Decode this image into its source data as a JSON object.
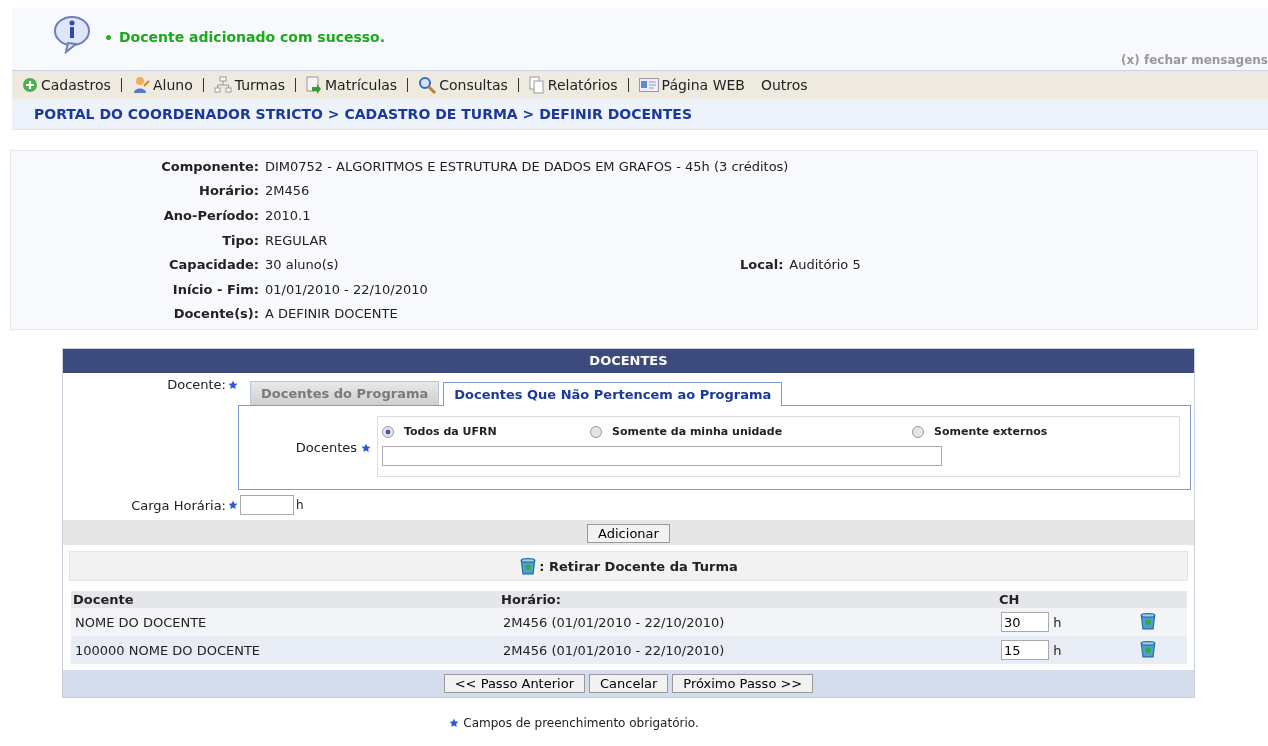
{
  "message": {
    "text": "Docente adicionado com sucesso.",
    "close": "(x) fechar mensagens"
  },
  "menu": [
    {
      "label": "Cadastros",
      "kind": "plus"
    },
    {
      "label": "Aluno",
      "kind": "person"
    },
    {
      "label": "Turmas",
      "kind": "tree"
    },
    {
      "label": "Matrículas",
      "kind": "document"
    },
    {
      "label": "Consultas",
      "kind": "search"
    },
    {
      "label": "Relatórios",
      "kind": "pages"
    },
    {
      "label": "Página WEB",
      "kind": "card"
    },
    {
      "label": "Outros",
      "kind": "plain"
    }
  ],
  "breadcrumb": "PORTAL DO COORDENADOR STRICTO > CADASTRO DE TURMA > DEFINIR DOCENTES",
  "details": [
    {
      "label": "Componente:",
      "value": "DIM0752 - ALGORITMOS E ESTRUTURA DE DADOS EM GRAFOS - 45h (3 créditos)"
    },
    {
      "label": "Horário:",
      "value": "2M456"
    },
    {
      "label": "Ano-Período:",
      "value": "2010.1"
    },
    {
      "label": "Tipo:",
      "value": "REGULAR"
    },
    {
      "label": "Capacidade:",
      "value": "30 aluno(s)",
      "extra_label": "Local:",
      "extra_value": "Auditório 5"
    },
    {
      "label": "Início - Fim:",
      "value": "01/01/2010 - 22/10/2010"
    },
    {
      "label": "Docente(s):",
      "value": "A DEFINIR DOCENTE"
    }
  ],
  "panel": {
    "title": "DOCENTES",
    "docente_label": "Docente:",
    "tabs": [
      {
        "label": "Docentes do Programa",
        "selected": false
      },
      {
        "label": "Docentes Que Não Pertencem ao Programa",
        "selected": true
      }
    ],
    "docentes_label": "Docentes",
    "radios": [
      {
        "label": "Todos da UFRN",
        "selected": true
      },
      {
        "label": "Somente da minha unidade",
        "selected": false
      },
      {
        "label": "Somente externos",
        "selected": false
      }
    ],
    "carga_label": "Carga Horária:",
    "carga_unit": "h",
    "add_button": "Adicionar",
    "legend": ": Retirar Docente da Turma",
    "columns": [
      "Docente",
      "Horário:",
      "CH"
    ],
    "rows": [
      {
        "docente": "NOME DO DOCENTE",
        "horario": "2M456 (01/01/2010 - 22/10/2010)",
        "ch": "30",
        "unit": "h"
      },
      {
        "docente": "100000 NOME DO DOCENTE",
        "horario": "2M456 (01/01/2010 - 22/10/2010)",
        "ch": "15",
        "unit": "h"
      }
    ],
    "buttons": [
      "<< Passo Anterior",
      "Cancelar",
      "Próximo Passo >>"
    ]
  },
  "footnote": "Campos de preenchimento obrigatório."
}
